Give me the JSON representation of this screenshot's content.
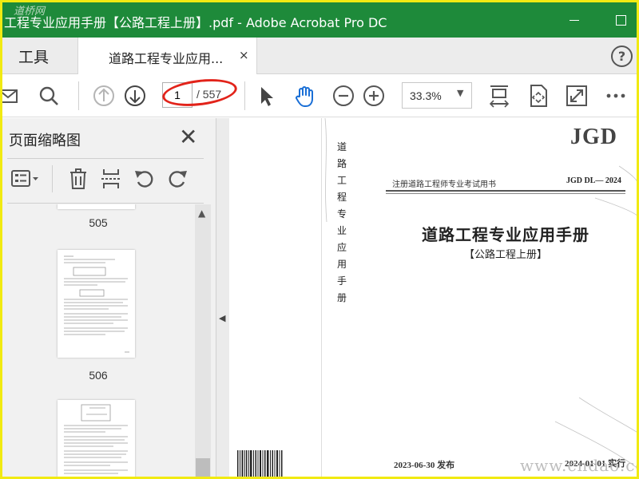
{
  "window": {
    "title": "工程专业应用手册【公路工程上册】.pdf - Adobe Acrobat Pro DC",
    "watermark": "道桥网"
  },
  "tabs": {
    "tools_label": "工具",
    "doc_label": "道路工程专业应用...",
    "close_glyph": "×",
    "help_glyph": "?"
  },
  "toolbar": {
    "page_current": "1",
    "page_total": "/ 557",
    "zoom": "33.3%",
    "icons": [
      "mail-icon",
      "search-icon",
      "page-up-icon",
      "page-down-icon",
      "select-cursor-icon",
      "hand-tool-icon",
      "zoom-out-icon",
      "zoom-in-icon",
      "fit-width-icon",
      "fit-page-icon",
      "fullscreen-icon",
      "more-icon"
    ]
  },
  "panel": {
    "title": "页面缩略图",
    "close_glyph": "✕",
    "thumbnails": [
      {
        "label": "505"
      },
      {
        "label": "506"
      }
    ]
  },
  "document": {
    "spine_title": "道路工程专业应用手册",
    "standard": "JGD",
    "series": "注册道路工程师专业考试用书",
    "code": "JGD DL— 2024",
    "title": "道路工程专业应用手册",
    "subtitle": "【公路工程上册】",
    "publish_date": "2023-06-30 发布",
    "implement_date": "2024-01-01 实行",
    "site_watermark": "www.cndao.com"
  },
  "colors": {
    "title_bar": "#1e8a3a",
    "highlight_oval": "#e2231a",
    "frame": "#f1ea12"
  }
}
